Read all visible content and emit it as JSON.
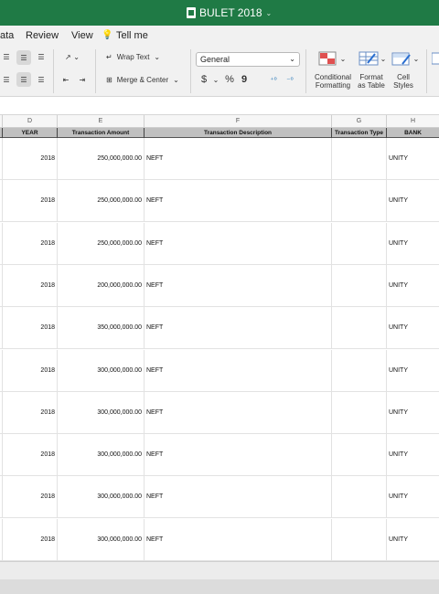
{
  "window": {
    "title": "BULET 2018"
  },
  "ribbon_tabs": [
    {
      "label": "ata"
    },
    {
      "label": "Review"
    },
    {
      "label": "View"
    },
    {
      "label": "Tell me"
    }
  ],
  "ribbon": {
    "wrap_text": "Wrap Text",
    "merge_center": "Merge & Center",
    "number_format": "General",
    "currency": "$",
    "percent": "%",
    "comma": "9",
    "conditional_formatting": [
      "Conditional",
      "Formatting"
    ],
    "format_as_table": [
      "Format",
      "as Table"
    ],
    "cell_styles": [
      "Cell",
      "Styles"
    ]
  },
  "sheet": {
    "columns": [
      "D",
      "E",
      "F",
      "G",
      "H"
    ],
    "headers": [
      "YEAR",
      "Transaction Amount",
      "Transaction Description",
      "Transaction Type",
      "BANK"
    ],
    "rows": [
      {
        "year": "2018",
        "amount": "250,000,000.00",
        "desc": "NEFT",
        "type": "",
        "bank": "UNITY"
      },
      {
        "year": "2018",
        "amount": "250,000,000.00",
        "desc": "NEFT",
        "type": "",
        "bank": "UNITY"
      },
      {
        "year": "2018",
        "amount": "250,000,000.00",
        "desc": "NEFT",
        "type": "",
        "bank": "UNITY"
      },
      {
        "year": "2018",
        "amount": "200,000,000.00",
        "desc": "NEFT",
        "type": "",
        "bank": "UNITY"
      },
      {
        "year": "2018",
        "amount": "350,000,000.00",
        "desc": "NEFT",
        "type": "",
        "bank": "UNITY"
      },
      {
        "year": "2018",
        "amount": "300,000,000.00",
        "desc": "NEFT",
        "type": "",
        "bank": "UNITY"
      },
      {
        "year": "2018",
        "amount": "300,000,000.00",
        "desc": "NEFT",
        "type": "",
        "bank": "UNITY"
      },
      {
        "year": "2018",
        "amount": "300,000,000.00",
        "desc": "NEFT",
        "type": "",
        "bank": "UNITY"
      },
      {
        "year": "2018",
        "amount": "300,000,000.00",
        "desc": "NEFT",
        "type": "",
        "bank": "UNITY"
      },
      {
        "year": "2018",
        "amount": "300,000,000.00",
        "desc": "NEFT",
        "type": "",
        "bank": "UNITY"
      }
    ]
  },
  "colors": {
    "titlebar": "#1f7a45",
    "header_fill": "#c0c0c0"
  }
}
